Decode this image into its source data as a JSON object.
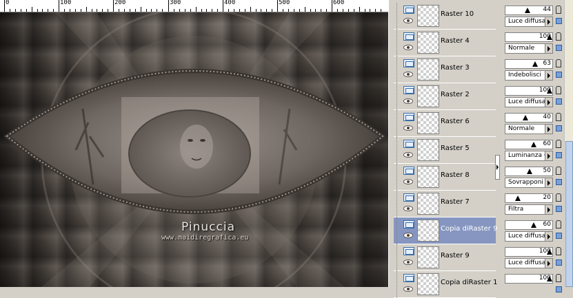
{
  "ruler": {
    "labels": [
      "0",
      "100",
      "200",
      "300",
      "400",
      "500",
      "600"
    ]
  },
  "canvas": {
    "watermark_title": "Pinuccia",
    "watermark_url": "www.maidiregrafica.eu"
  },
  "layers": [
    {
      "name": "Raster 10",
      "selected": false,
      "opacity": "44",
      "blend": "Luce diffusa",
      "opacity_value": 44
    },
    {
      "name": "Raster 4",
      "selected": false,
      "opacity": "100",
      "blend": "Normale",
      "opacity_value": 100
    },
    {
      "name": "Raster 3",
      "selected": false,
      "opacity": "63",
      "blend": "Indebolisci",
      "opacity_value": 63
    },
    {
      "name": "Raster 2",
      "selected": false,
      "opacity": "100",
      "blend": "Luce diffusa",
      "opacity_value": 100
    },
    {
      "name": "Raster 6",
      "selected": false,
      "opacity": "40",
      "blend": "Normale",
      "opacity_value": 40
    },
    {
      "name": "Raster 5",
      "selected": false,
      "opacity": "60",
      "blend": "Luminanza (L)",
      "opacity_value": 60
    },
    {
      "name": "Raster 8",
      "selected": false,
      "opacity": "50",
      "blend": "Sovrapponi",
      "opacity_value": 50
    },
    {
      "name": "Raster 7",
      "selected": false,
      "opacity": "20",
      "blend": "Filtra",
      "opacity_value": 20
    },
    {
      "name": "Copia diRaster 9",
      "selected": true,
      "opacity": "60",
      "blend": "Luce diffusa",
      "opacity_value": 60
    },
    {
      "name": "Raster 9",
      "selected": false,
      "opacity": "100",
      "blend": "Luce diffusa",
      "opacity_value": 100
    },
    {
      "name": "Copia diRaster 1",
      "selected": false,
      "opacity": "100",
      "blend": "",
      "opacity_value": 100
    }
  ],
  "colors": {
    "selected_row": "#8696c0",
    "panel_bg": "#d4d0c8"
  }
}
